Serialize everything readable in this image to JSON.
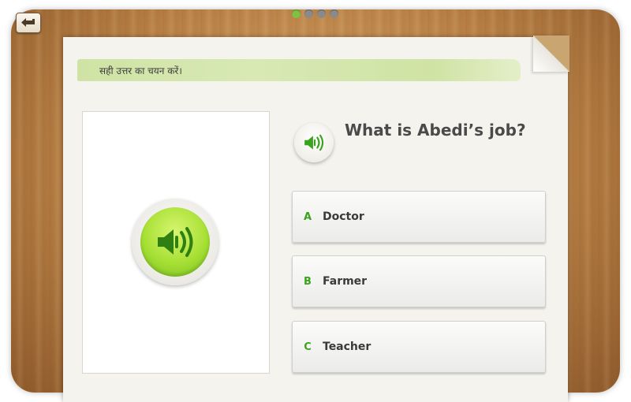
{
  "nav": {
    "back_icon": "back-arrow-icon",
    "pages": [
      {
        "active": true
      },
      {
        "active": false
      },
      {
        "active": false
      },
      {
        "active": false
      }
    ]
  },
  "instruction": "सही उत्तर का चयन करें।",
  "question": {
    "text": "What is Abedi’s job?",
    "audio_icon": "speaker-icon"
  },
  "picture": {
    "audio_icon": "speaker-icon"
  },
  "options": [
    {
      "letter": "A",
      "label": "Doctor"
    },
    {
      "letter": "B",
      "label": "Farmer"
    },
    {
      "letter": "C",
      "label": "Teacher"
    }
  ],
  "colors": {
    "accent_green": "#3aa31e",
    "active_dot": "#7ec241",
    "speaker_green": "#a8e035"
  }
}
